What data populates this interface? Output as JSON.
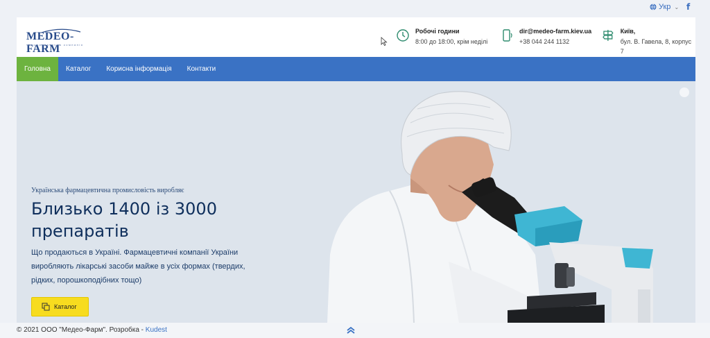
{
  "topbar": {
    "language": "Укр",
    "facebook_glyph": "f"
  },
  "header": {
    "logo": {
      "name": "MEDEO-FARM",
      "tagline": "фармацевтична компанія"
    },
    "hours": {
      "title": "Робочі години",
      "value": "8:00 до 18:00, крім неділі"
    },
    "contact": {
      "email": "dir@medeo-farm.kiev.ua",
      "phone": "+38 044 244 1132"
    },
    "address": {
      "city": "Київ,",
      "street": "бул. В. Гавела, 8, корпус 7"
    }
  },
  "nav": {
    "items": [
      "Головна",
      "Каталог",
      "Корисна інформація",
      "Контакти"
    ],
    "active": 0
  },
  "hero": {
    "eyebrow": "Українська фармацевтична промисловість виробляє",
    "headline": "Близько 1400 із 3000 препаратів",
    "description": "Що продаються в Україні. Фармацевтичні компанії України виробляють лікарські засоби майже в усіх формах (твердих, рідких, порошкоподібних тощо)",
    "cta_label": "Каталог"
  },
  "footer": {
    "copyright": "© 2021 ООО \"Медео-Фарм\". Розробка - ",
    "developer": "Kudest"
  },
  "colors": {
    "nav": "#3a72c4",
    "nav_active": "#6db33f",
    "cta": "#f7dc1f",
    "headline": "#0f2f5c",
    "hero_bg": "#dde4ec"
  },
  "icons": [
    "globe-icon",
    "chevron-down-icon",
    "facebook-icon",
    "clock-icon",
    "phone-icon",
    "signpost-icon",
    "cursor-icon",
    "copy-icon",
    "double-chevron-up-icon"
  ]
}
